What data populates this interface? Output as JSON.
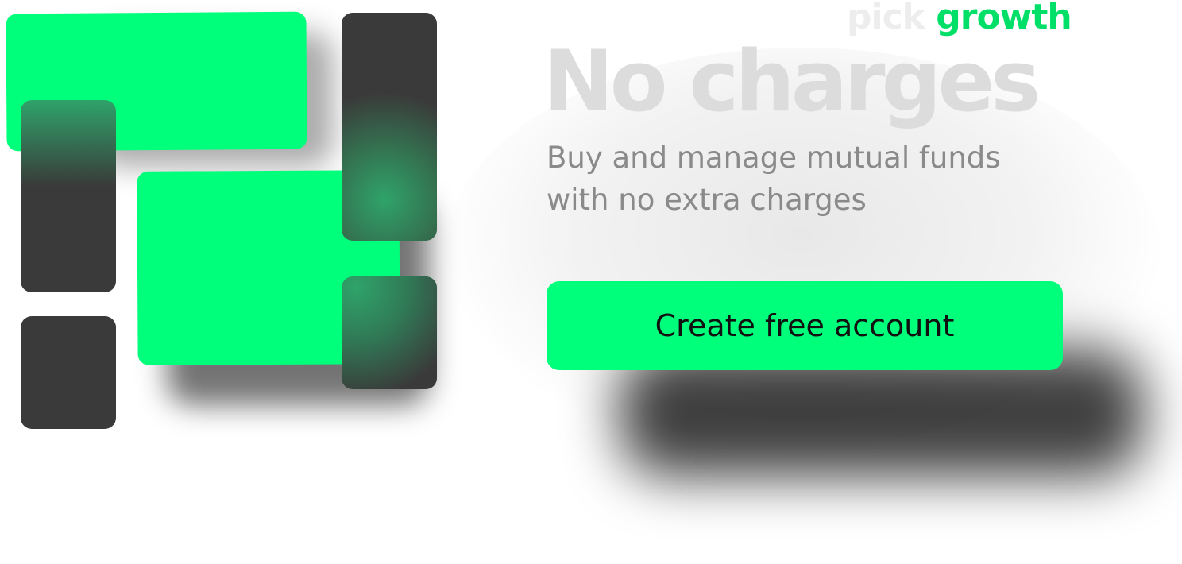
{
  "brand": {
    "word_pick": "pick",
    "word_growth": "growth",
    "accent_color": "#00e069"
  },
  "hero": {
    "headline": "No charges",
    "subtitle_line1": "Buy and manage mutual funds",
    "subtitle_line2": "with no extra charges"
  },
  "cta": {
    "label": "Create free account",
    "background_color": "#00ff7a"
  },
  "logo_graphic": {
    "icon": "block-logo-icon",
    "colors": {
      "green": "#00ff7a",
      "dark": "#3a3a3a"
    }
  }
}
